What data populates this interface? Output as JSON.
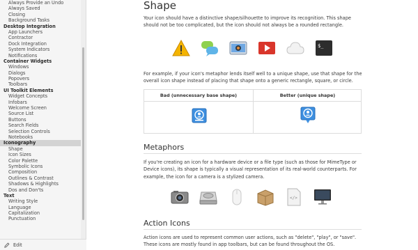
{
  "sidebar": {
    "rows": [
      {
        "label": "Always Provide an Undo",
        "kind": "item"
      },
      {
        "label": "Always Saved",
        "kind": "item"
      },
      {
        "label": "Closing",
        "kind": "item"
      },
      {
        "label": "Background Tasks",
        "kind": "item"
      },
      {
        "label": "Desktop Integration",
        "kind": "group"
      },
      {
        "label": "App Launchers",
        "kind": "item"
      },
      {
        "label": "Contractor",
        "kind": "item"
      },
      {
        "label": "Dock Integration",
        "kind": "item"
      },
      {
        "label": "System Indicators",
        "kind": "item"
      },
      {
        "label": "Notifications",
        "kind": "item"
      },
      {
        "label": "Container Widgets",
        "kind": "group"
      },
      {
        "label": "Windows",
        "kind": "item"
      },
      {
        "label": "Dialogs",
        "kind": "item"
      },
      {
        "label": "Popovers",
        "kind": "item"
      },
      {
        "label": "Toolbars",
        "kind": "item"
      },
      {
        "label": "UI Toolkit Elements",
        "kind": "group"
      },
      {
        "label": "Widget Concepts",
        "kind": "item"
      },
      {
        "label": "Infobars",
        "kind": "item"
      },
      {
        "label": "Welcome Screen",
        "kind": "item"
      },
      {
        "label": "Source List",
        "kind": "item"
      },
      {
        "label": "Buttons",
        "kind": "item"
      },
      {
        "label": "Search Fields",
        "kind": "item"
      },
      {
        "label": "Selection Controls",
        "kind": "item"
      },
      {
        "label": "Notebooks",
        "kind": "item"
      },
      {
        "label": "Iconography",
        "kind": "active"
      },
      {
        "label": "Shape",
        "kind": "item"
      },
      {
        "label": "Icon Sizes",
        "kind": "item"
      },
      {
        "label": "Color Palette",
        "kind": "item"
      },
      {
        "label": "Symbolic Icons",
        "kind": "item"
      },
      {
        "label": "Composition",
        "kind": "item"
      },
      {
        "label": "Outlines & Contrast",
        "kind": "item"
      },
      {
        "label": "Shadows & Highlights",
        "kind": "item"
      },
      {
        "label": "Dos and Don'ts",
        "kind": "item"
      },
      {
        "label": "Text",
        "kind": "group"
      },
      {
        "label": "Writing Style",
        "kind": "item"
      },
      {
        "label": "Language",
        "kind": "item"
      },
      {
        "label": "Capitalization",
        "kind": "item"
      },
      {
        "label": "Punctuation",
        "kind": "item"
      }
    ],
    "edit_label": "Edit"
  },
  "main": {
    "shape_title": "Shape",
    "shape_para": "Your icon should have a distinctive shape/silhouette to improve its recognition. This shape should not be too complicated, but the icon should not always be a rounded rectangle.",
    "shape_icons": [
      "warning-icon",
      "chat-bubbles-icon",
      "screenshot-icon",
      "video-player-icon",
      "cloud-icon",
      "terminal-icon"
    ],
    "example_para": "For example, if your icon's metaphor lends itself well to a unique shape, use that shape for the overall icon shape instead of placing that shape onto a generic rectangle, square, or circle.",
    "table": {
      "bad_header": "Bad (unnecessary base shape)",
      "good_header": "Better (unique shape)"
    },
    "metaphors_title": "Metaphors",
    "metaphors_para": "If you're creating an icon for a hardware device or a file type (such as those for MimeType or Device icons), its shape is typically a visual representation of its real-world counterparts. For example, the icon for a camera is a stylized camera.",
    "metaphor_icons": [
      "camera-icon",
      "hard-drive-icon",
      "mouse-icon",
      "package-icon",
      "html-file-icon",
      "monitor-icon"
    ],
    "action_title": "Action Icons",
    "action_para": "Action icons are used to represent common user actions, such as \"delete\", \"play\", or \"save\". These icons are mostly found in app toolbars, but can be found throughout the OS."
  },
  "colors": {
    "accent_blue": "#3d8fe0",
    "sidebar_bg": "#f5f5f5",
    "active_bg": "#d3d3d3"
  }
}
